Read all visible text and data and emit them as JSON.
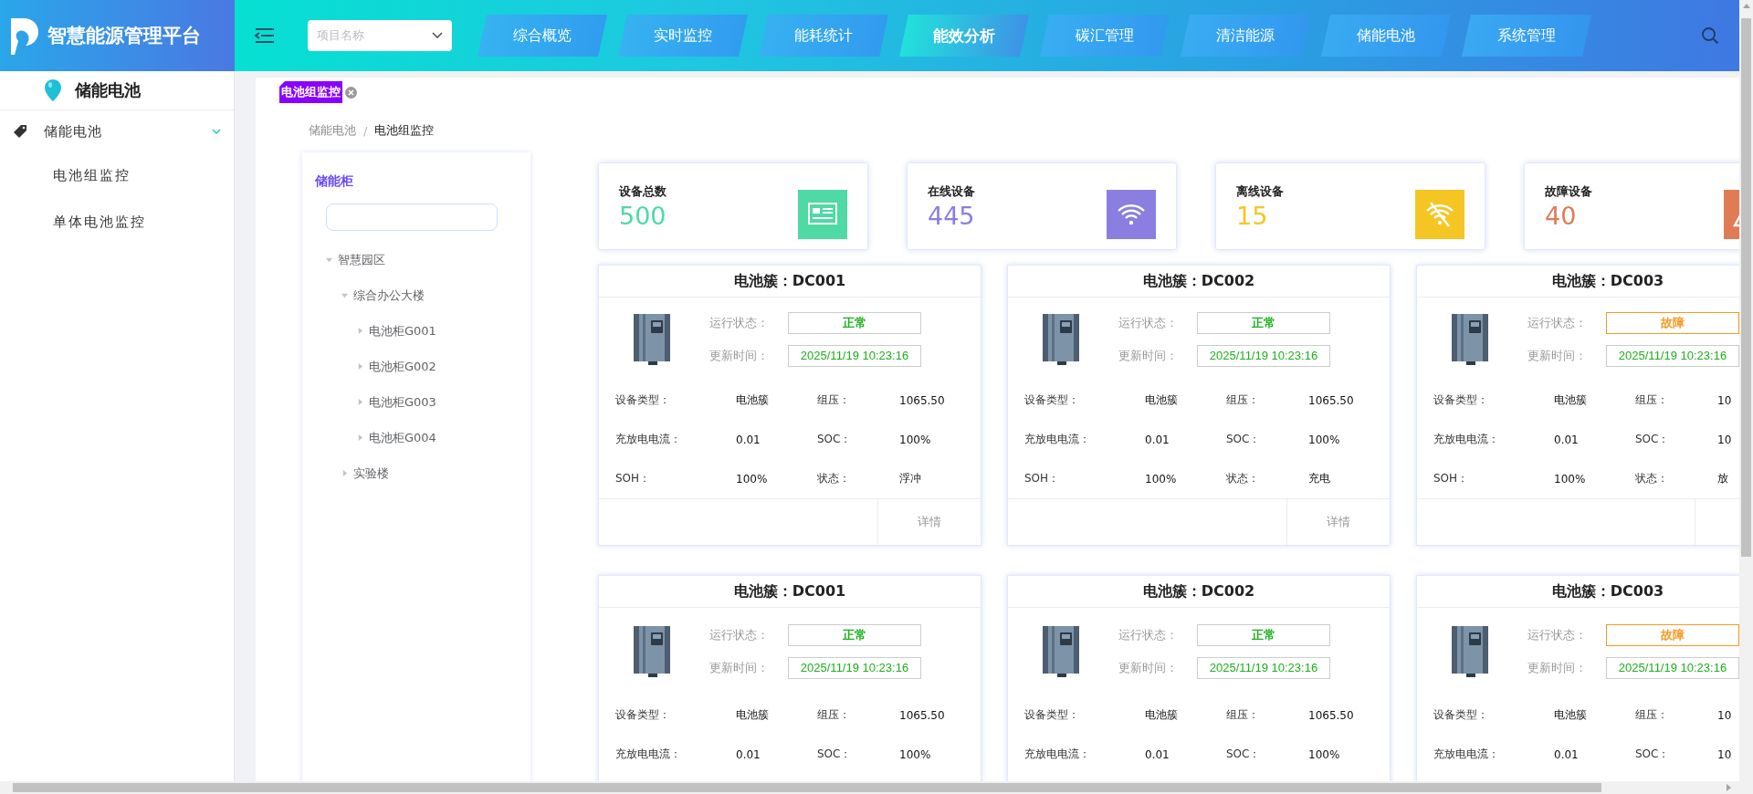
{
  "logo": {
    "title": "智慧能源管理平台"
  },
  "topbar": {
    "project_select": {
      "placeholder": "项目名称"
    },
    "nav": [
      {
        "label": "综合概览",
        "selected": false
      },
      {
        "label": "实时监控",
        "selected": false
      },
      {
        "label": "能耗统计",
        "selected": false
      },
      {
        "label": "能效分析",
        "selected": true
      },
      {
        "label": "碳汇管理",
        "selected": false
      },
      {
        "label": "清洁能源",
        "selected": false
      },
      {
        "label": "储能电池",
        "selected": false
      },
      {
        "label": "系统管理",
        "selected": false
      }
    ]
  },
  "sidebar": {
    "title": "储能电池",
    "menu": [
      {
        "label": "储能电池",
        "expanded": true,
        "children": [
          {
            "label": "电池组监控"
          },
          {
            "label": "单体电池监控"
          }
        ]
      }
    ]
  },
  "tabs": [
    {
      "label": "电池组监控"
    }
  ],
  "breadcrumb": {
    "separator": "/",
    "items": [
      "储能电池",
      "电池组监控"
    ]
  },
  "tree": {
    "title": "储能柜",
    "nodes": [
      {
        "label": "智慧园区",
        "expanded": true,
        "children": [
          {
            "label": "综合办公大楼",
            "expanded": true,
            "children": [
              {
                "label": "电池柜G001",
                "expanded": false
              },
              {
                "label": "电池柜G002",
                "expanded": false
              },
              {
                "label": "电池柜G003",
                "expanded": false
              },
              {
                "label": "电池柜G004",
                "expanded": false
              }
            ]
          },
          {
            "label": "实验楼",
            "expanded": false
          }
        ]
      }
    ]
  },
  "stats": [
    {
      "kind": "total",
      "label": "设备总数",
      "value": "500",
      "color": "#4fd9a5"
    },
    {
      "kind": "online",
      "label": "在线设备",
      "value": "445",
      "color": "#8a7ee0"
    },
    {
      "kind": "offline",
      "label": "离线设备",
      "value": "15",
      "color": "#f5c523"
    },
    {
      "kind": "fault",
      "label": "故障设备",
      "value": "40",
      "color": "#e07b56"
    }
  ],
  "cards": [
    {
      "title": "电池簇：DC001",
      "status_label": "运行状态：",
      "status": "正常",
      "fault": false,
      "time_label": "更新时间：",
      "time": "2025/11/19 10:23:16",
      "fields": [
        {
          "label": "设备类型：",
          "value": "电池簇"
        },
        {
          "label": "组压：",
          "value": "1065.50"
        },
        {
          "label": "充放电电流：",
          "value": "0.01"
        },
        {
          "label": "SOC：",
          "value": "100%"
        },
        {
          "label": "SOH：",
          "value": "100%"
        },
        {
          "label": "状态：",
          "value": "浮冲"
        }
      ],
      "detail": "详情"
    },
    {
      "title": "电池簇：DC002",
      "status_label": "运行状态：",
      "status": "正常",
      "fault": false,
      "time_label": "更新时间：",
      "time": "2025/11/19 10:23:16",
      "fields": [
        {
          "label": "设备类型：",
          "value": "电池簇"
        },
        {
          "label": "组压：",
          "value": "1065.50"
        },
        {
          "label": "充放电电流：",
          "value": "0.01"
        },
        {
          "label": "SOC：",
          "value": "100%"
        },
        {
          "label": "SOH：",
          "value": "100%"
        },
        {
          "label": "状态：",
          "value": "充电"
        }
      ],
      "detail": "详情"
    },
    {
      "title": "电池簇：DC003",
      "status_label": "运行状态：",
      "status": "故障",
      "fault": true,
      "time_label": "更新时间：",
      "time": "2025/11/19 10:23:16",
      "fields": [
        {
          "label": "设备类型：",
          "value": "电池簇"
        },
        {
          "label": "组压：",
          "value": "10"
        },
        {
          "label": "充放电电流：",
          "value": "0.01"
        },
        {
          "label": "SOC：",
          "value": "10"
        },
        {
          "label": "SOH：",
          "value": "100%"
        },
        {
          "label": "状态：",
          "value": "放"
        }
      ]
    },
    {
      "title": "电池簇：DC001",
      "status_label": "运行状态：",
      "status": "正常",
      "fault": false,
      "time_label": "更新时间：",
      "time": "2025/11/19 10:23:16",
      "fields": [
        {
          "label": "设备类型：",
          "value": "电池簇"
        },
        {
          "label": "组压：",
          "value": "1065.50"
        },
        {
          "label": "充放电电流：",
          "value": "0.01"
        },
        {
          "label": "SOC：",
          "value": "100%"
        }
      ]
    },
    {
      "title": "电池簇：DC002",
      "status_label": "运行状态：",
      "status": "正常",
      "fault": false,
      "time_label": "更新时间：",
      "time": "2025/11/19 10:23:16",
      "fields": [
        {
          "label": "设备类型：",
          "value": "电池簇"
        },
        {
          "label": "组压：",
          "value": "1065.50"
        },
        {
          "label": "充放电电流：",
          "value": "0.01"
        },
        {
          "label": "SOC：",
          "value": "100%"
        }
      ]
    },
    {
      "title": "电池簇：DC003",
      "status_label": "运行状态：",
      "status": "故障",
      "fault": true,
      "time_label": "更新时间：",
      "time": "2025/11/19 10:23:16",
      "fields": [
        {
          "label": "设备类型：",
          "value": "电池簇"
        },
        {
          "label": "组压：",
          "value": "10"
        },
        {
          "label": "充放电电流：",
          "value": "0.01"
        },
        {
          "label": "SOC：",
          "value": "10"
        }
      ]
    }
  ]
}
